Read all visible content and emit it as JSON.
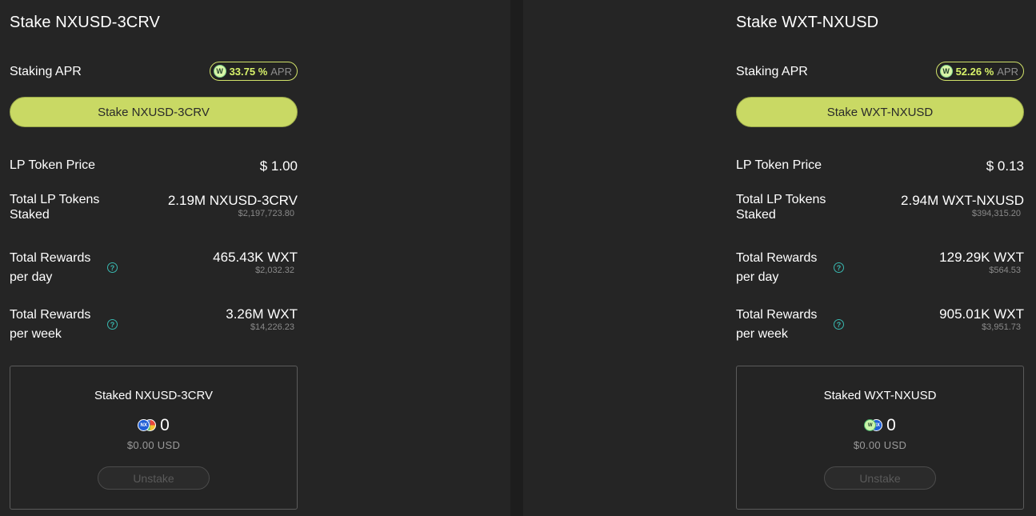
{
  "pools": [
    {
      "title": "Stake NXUSD-3CRV",
      "apr_label": "Staking APR",
      "apr_value": "33.75 %",
      "apr_unit": "APR",
      "apr_coin_letter": "W",
      "stake_button": "Stake NXUSD-3CRV",
      "lp_price_label": "LP Token Price",
      "lp_price_value": "$ 1.00",
      "total_staked_label_1": "Total LP Tokens",
      "total_staked_label_2": "Staked",
      "total_staked_value": "2.19M NXUSD-3CRV",
      "total_staked_usd": "$2,197,723.80",
      "rewards_day_label_1": "Total Rewards",
      "rewards_day_label_2": "per day",
      "rewards_day_value": "465.43K WXT",
      "rewards_day_usd": "$2,032.32",
      "rewards_week_label_1": "Total Rewards",
      "rewards_week_label_2": "per week",
      "rewards_week_value": "3.26M WXT",
      "rewards_week_usd": "$14,226.23",
      "help_glyph": "?",
      "staked_title": "Staked NXUSD-3CRV",
      "staked_amount": "0",
      "staked_usd": "$0.00 USD",
      "unstake_button": "Unstake",
      "token_a_label": "NX",
      "token_icons": [
        "nxusd-token-icon",
        "3crv-token-icon"
      ]
    },
    {
      "title": "Stake WXT-NXUSD",
      "apr_label": "Staking APR",
      "apr_value": "52.26 %",
      "apr_unit": "APR",
      "apr_coin_letter": "W",
      "stake_button": "Stake WXT-NXUSD",
      "lp_price_label": "LP Token Price",
      "lp_price_value": "$ 0.13",
      "total_staked_label_1": "Total LP Tokens",
      "total_staked_label_2": "Staked",
      "total_staked_value": "2.94M WXT-NXUSD",
      "total_staked_usd": "$394,315.20",
      "rewards_day_label_1": "Total Rewards",
      "rewards_day_label_2": "per day",
      "rewards_day_value": "129.29K WXT",
      "rewards_day_usd": "$564.53",
      "rewards_week_label_1": "Total Rewards",
      "rewards_week_label_2": "per week",
      "rewards_week_value": "905.01K WXT",
      "rewards_week_usd": "$3,951.73",
      "help_glyph": "?",
      "staked_title": "Staked WXT-NXUSD",
      "staked_amount": "0",
      "staked_usd": "$0.00 USD",
      "unstake_button": "Unstake",
      "token_a_label": "W",
      "token_b_label": "NX",
      "token_icons": [
        "wxt-token-icon",
        "nxusd-token-icon"
      ]
    }
  ],
  "colors": {
    "accent": "#c9d964",
    "apr_text": "#d8f26a",
    "help_icon": "#39b8b0",
    "background": "#252525"
  }
}
